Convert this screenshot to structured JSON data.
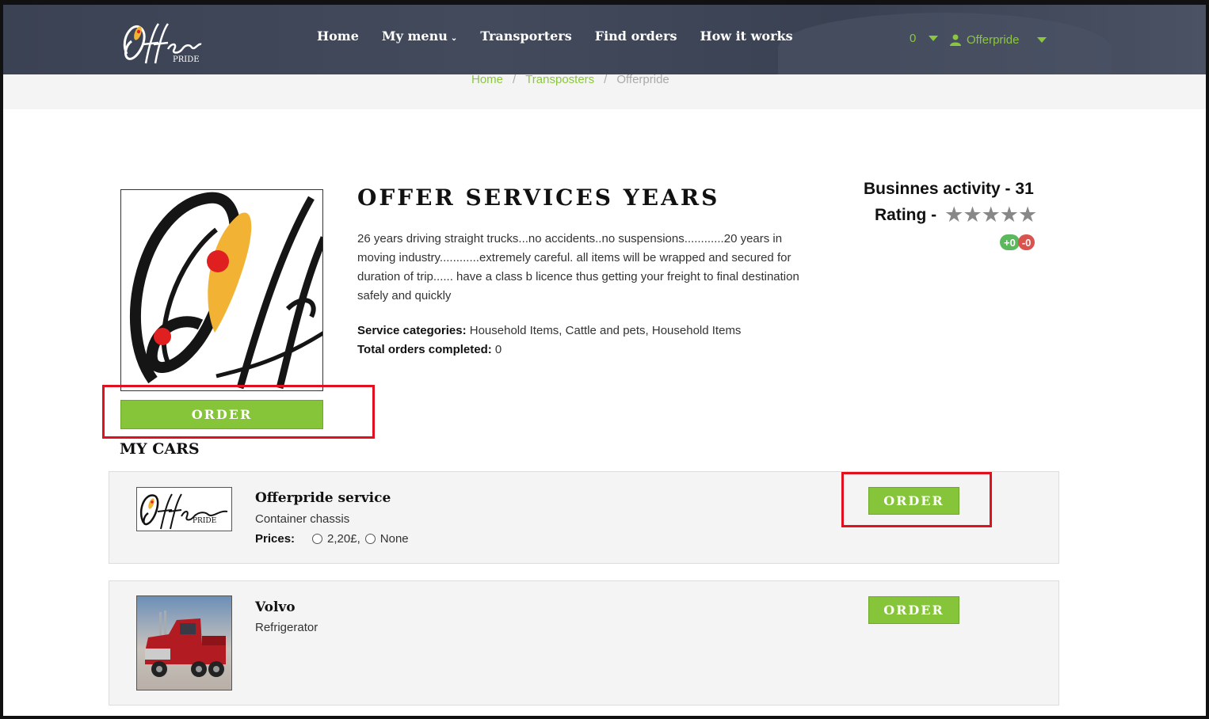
{
  "header": {
    "logo_main": "Offer",
    "logo_sub": "PRIDE",
    "nav": [
      {
        "label": "Home"
      },
      {
        "label": "My menu"
      },
      {
        "label": "Transporters"
      },
      {
        "label": "Find orders"
      },
      {
        "label": "How it works"
      }
    ],
    "cart_count": "0",
    "username": "Offerpride"
  },
  "breadcrumb": {
    "home": "Home",
    "sep": "/",
    "transporters": "Transposters",
    "current": "Offerpride"
  },
  "profile": {
    "title": "OFFER SERVICES YEARS",
    "description": "26 years driving straight trucks...no accidents..no suspensions............20 years in moving industry............extremely careful. all items will be wrapped and secured for duration of trip...... have a class b licence thus getting your freight to final destination safely and quickly",
    "service_categories_label": "Service categories:",
    "service_categories": "Household Items, Cattle and pets, Household Items",
    "total_orders_label": "Total orders completed:",
    "total_orders": "0",
    "order_label": "ORDER",
    "activity_text": "Businnes activity - 31",
    "rating_label": "Rating -",
    "stars": "★★★★★",
    "votes_plus": "+0",
    "votes_minus": "-0"
  },
  "cars_section": {
    "title": "MY CARS",
    "cars": [
      {
        "name": "Offerpride service",
        "type": "Container chassis",
        "prices_label": "Prices:",
        "price_options": [
          "2,20£,",
          "None"
        ],
        "order_label": "ORDER"
      },
      {
        "name": "Volvo",
        "type": "Refrigerator",
        "order_label": "ORDER"
      }
    ]
  },
  "colors": {
    "header_bg": "#3a4152",
    "accent_green": "#86c43a",
    "highlight_red": "#e0101e"
  }
}
